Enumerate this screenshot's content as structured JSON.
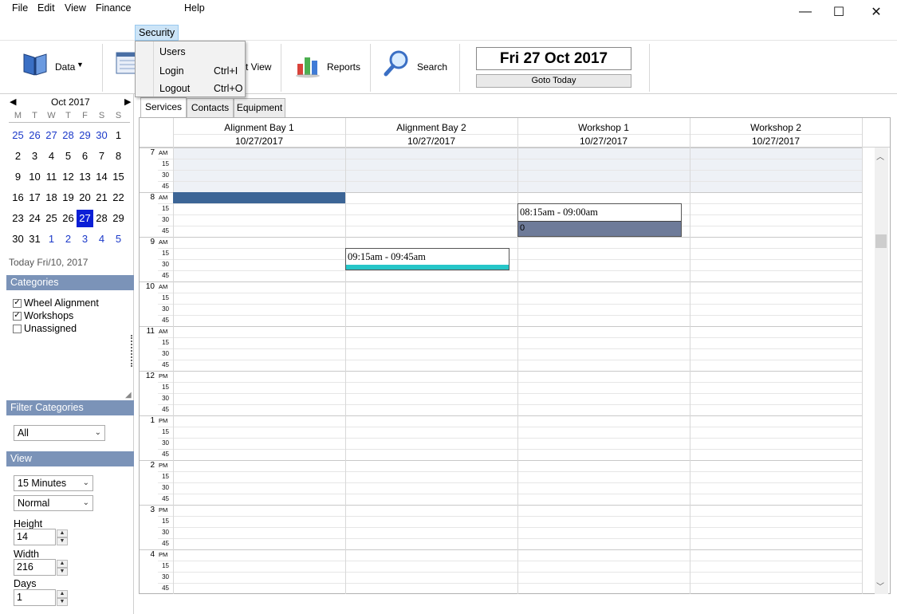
{
  "window": {
    "min_glyph": "—",
    "max_glyph": "☐",
    "close_glyph": "✕"
  },
  "menu": {
    "file": "File",
    "edit": "Edit",
    "view": "View",
    "finance": "Finance",
    "security": "Security",
    "help": "Help"
  },
  "security_menu": [
    {
      "label": "Users",
      "shortcut": ""
    },
    {
      "label": "Login",
      "shortcut": "Ctrl+I"
    },
    {
      "label": "Logout",
      "shortcut": "Ctrl+O"
    }
  ],
  "toolbar": {
    "data_label": "Data",
    "partial_view_label": "t View",
    "reports_label": "Reports",
    "search_label": "Search",
    "current_date": "Fri 27 Oct 2017",
    "goto_today_label": "Goto Today"
  },
  "calendar": {
    "month_label": "Oct 2017",
    "prev_glyph": "◀",
    "next_glyph": "▶",
    "dow": [
      "M",
      "T",
      "W",
      "T",
      "F",
      "S",
      "S"
    ],
    "weeks": [
      [
        "25",
        "26",
        "27",
        "28",
        "29",
        "30",
        "1"
      ],
      [
        "2",
        "3",
        "4",
        "5",
        "6",
        "7",
        "8"
      ],
      [
        "9",
        "10",
        "11",
        "12",
        "13",
        "14",
        "15"
      ],
      [
        "16",
        "17",
        "18",
        "19",
        "20",
        "21",
        "22"
      ],
      [
        "23",
        "24",
        "25",
        "26",
        "27",
        "28",
        "29"
      ],
      [
        "30",
        "31",
        "1",
        "2",
        "3",
        "4",
        "5"
      ]
    ],
    "selected": "27",
    "today_text": "Today Fri/10, 2017"
  },
  "categories": {
    "title": "Categories",
    "items": [
      {
        "label": "Wheel Alignment",
        "checked": true
      },
      {
        "label": "Workshops",
        "checked": true
      },
      {
        "label": "Unassigned",
        "checked": false
      }
    ]
  },
  "filter": {
    "title": "Filter Categories",
    "value": "All"
  },
  "view_panel": {
    "title": "View",
    "interval": "15 Minutes",
    "mode": "Normal",
    "height_label": "Height",
    "height_value": "14",
    "width_label": "Width",
    "width_value": "216",
    "days_label": "Days",
    "days_value": "1"
  },
  "tabs": [
    "Services",
    "Contacts",
    "Equipment"
  ],
  "resources": [
    {
      "name": "Alignment Bay 1",
      "date": "10/27/2017"
    },
    {
      "name": "Alignment Bay 2",
      "date": "10/27/2017"
    },
    {
      "name": "Workshop 1",
      "date": "10/27/2017"
    },
    {
      "name": "Workshop 2",
      "date": "10/27/2017"
    }
  ],
  "time_slots": {
    "hours": [
      {
        "hour": "7",
        "ampm": "AM"
      },
      {
        "hour": "8",
        "ampm": "AM"
      },
      {
        "hour": "9",
        "ampm": "AM"
      },
      {
        "hour": "10",
        "ampm": "AM"
      },
      {
        "hour": "11",
        "ampm": "AM"
      },
      {
        "hour": "12",
        "ampm": "PM"
      },
      {
        "hour": "1",
        "ampm": "PM"
      },
      {
        "hour": "2",
        "ampm": "PM"
      },
      {
        "hour": "3",
        "ampm": "PM"
      },
      {
        "hour": "4",
        "ampm": "PM"
      }
    ],
    "minutes": [
      "15",
      "30",
      "45"
    ]
  },
  "appointments": [
    {
      "resource": "Workshop 1",
      "time": "08:15am - 09:00am",
      "subtitle": "0",
      "color": "#6e7b99"
    },
    {
      "resource": "Alignment Bay 2",
      "time": "09:15am - 09:45am",
      "subtitle": "",
      "color": "#26c6c8"
    }
  ],
  "colors": {
    "section_header": "#7b93b8",
    "selected_day": "#0b1fd6",
    "other_month_day": "#1b39c9",
    "offhours_bg": "#eef1f6",
    "appt_bar_8am": "#3c6596"
  }
}
